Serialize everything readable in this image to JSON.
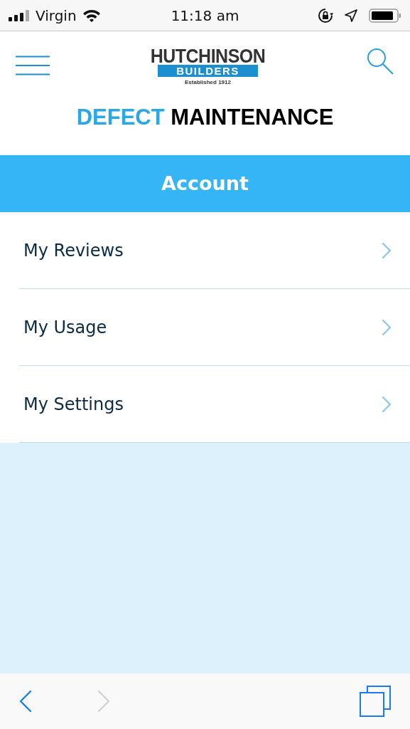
{
  "status_bar": {
    "carrier": "Virgin",
    "time": "11:18 am"
  },
  "header": {
    "logo": {
      "name": "HUTCHINSON",
      "band": "BUILDERS",
      "tagline": "Established 1912"
    },
    "title_accent": "DEFECT",
    "title_main": "MAINTENANCE"
  },
  "section": {
    "title": "Account"
  },
  "menu_items": [
    {
      "label": "My Reviews"
    },
    {
      "label": "My Usage"
    },
    {
      "label": "My Settings"
    }
  ],
  "toolbar": {
    "back_disabled": false,
    "forward_disabled": true
  }
}
